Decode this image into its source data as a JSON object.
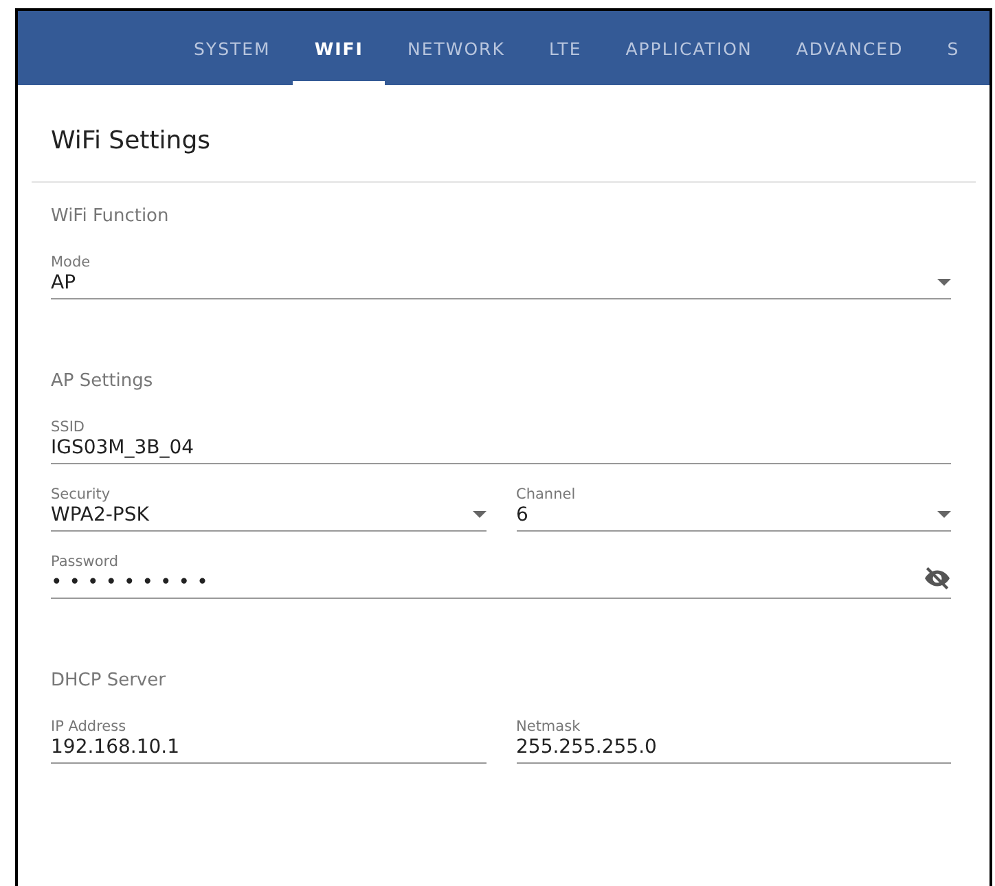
{
  "tabs": [
    {
      "label": "SYSTEM",
      "selected": false
    },
    {
      "label": "WIFI",
      "selected": true
    },
    {
      "label": "NETWORK",
      "selected": false
    },
    {
      "label": "LTE",
      "selected": false
    },
    {
      "label": "APPLICATION",
      "selected": false
    },
    {
      "label": "ADVANCED",
      "selected": false
    },
    {
      "label": "S",
      "selected": false
    }
  ],
  "title": "WiFi Settings",
  "sections": [
    {
      "heading": "WiFi Function",
      "rows": [
        [
          {
            "kind": "select",
            "label": "Mode",
            "value": "AP"
          }
        ]
      ]
    },
    {
      "heading": "AP Settings",
      "rows": [
        [
          {
            "kind": "text",
            "label": "SSID",
            "value": "IGS03M_3B_04"
          }
        ],
        [
          {
            "kind": "select",
            "label": "Security",
            "value": "WPA2-PSK"
          },
          {
            "kind": "select",
            "label": "Channel",
            "value": "6"
          }
        ],
        [
          {
            "kind": "password",
            "label": "Password",
            "value": "•••••••••"
          }
        ]
      ]
    },
    {
      "heading": "DHCP Server",
      "rows": [
        [
          {
            "kind": "text",
            "label": "IP Address",
            "value": "192.168.10.1"
          },
          {
            "kind": "text",
            "label": "Netmask",
            "value": "255.255.255.0"
          }
        ]
      ]
    }
  ]
}
